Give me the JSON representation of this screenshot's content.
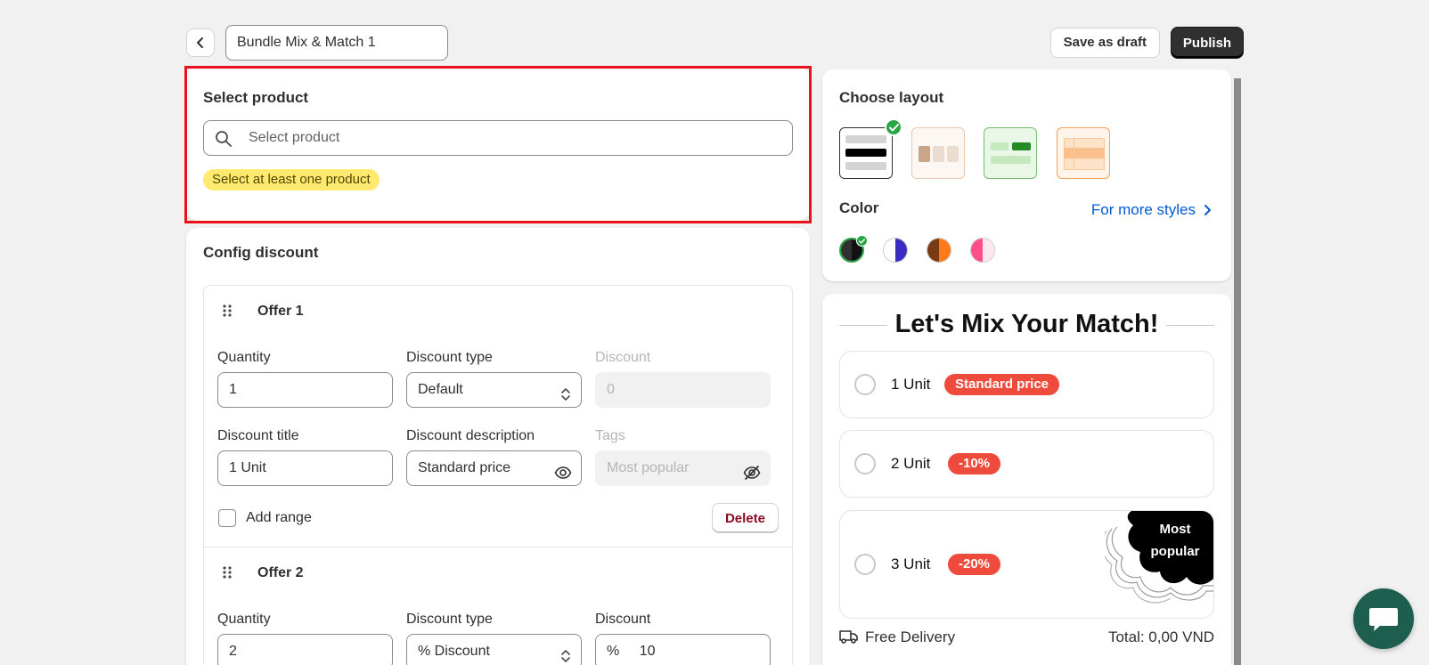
{
  "header": {
    "bundle_name": "Bundle Mix & Match 1",
    "save_draft_label": "Save as draft",
    "publish_label": "Publish"
  },
  "select_product": {
    "title": "Select product",
    "search_placeholder": "Select product",
    "warning": "Select at least one product"
  },
  "config": {
    "title": "Config discount",
    "offers": [
      {
        "title": "Offer 1",
        "quantity_label": "Quantity",
        "quantity": "1",
        "discount_type_label": "Discount type",
        "discount_type": "Default",
        "discount_label": "Discount",
        "discount": "0",
        "discount_title_label": "Discount title",
        "discount_title": "1 Unit",
        "discount_desc_label": "Discount description",
        "discount_desc": "Standard price",
        "tags_label": "Tags",
        "tags_placeholder": "Most popular",
        "add_range_label": "Add range",
        "delete_label": "Delete"
      },
      {
        "title": "Offer 2",
        "quantity_label": "Quantity",
        "quantity": "2",
        "discount_type_label": "Discount type",
        "discount_type": "% Discount",
        "discount_label": "Discount",
        "discount_prefix": "%",
        "discount": "10"
      }
    ]
  },
  "layout": {
    "title": "Choose layout",
    "color_title": "Color",
    "more_styles": "For more styles",
    "selected_layout": 0,
    "selected_color": 0
  },
  "preview": {
    "title": "Let's Mix Your Match!",
    "options": [
      {
        "unit": "1 Unit",
        "tag": "Standard price"
      },
      {
        "unit": "2 Unit",
        "tag": "-10%"
      },
      {
        "unit": "3 Unit",
        "tag": "-20%",
        "ribbon": "Most popular"
      }
    ],
    "delivery": "Free Delivery",
    "total": "Total: 0,00 VND"
  },
  "colors": {
    "accent": "#303030",
    "highlight_border": "#e8131b",
    "tag_red": "#ef4b3d",
    "check_green": "#29a644",
    "link_blue": "#005bd3"
  }
}
